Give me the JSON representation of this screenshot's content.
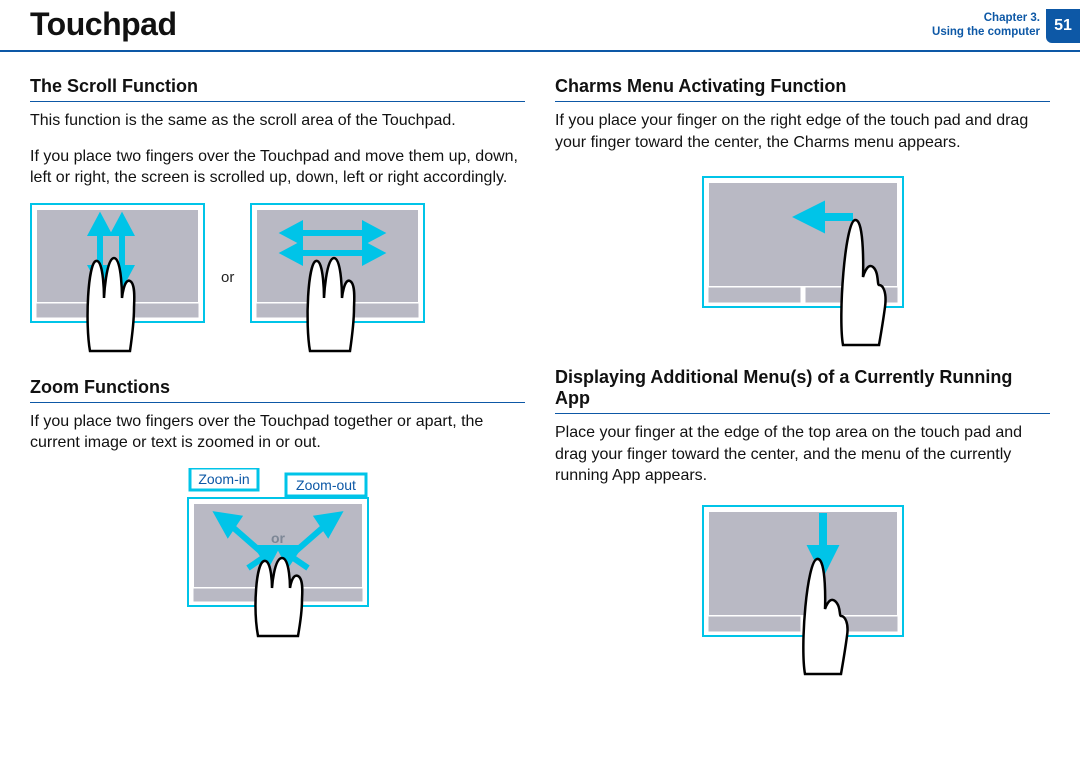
{
  "header": {
    "title": "Touchpad",
    "chapter_line1": "Chapter 3.",
    "chapter_line2": "Using the computer",
    "page_number": "51"
  },
  "left": {
    "scroll": {
      "heading": "The Scroll Function",
      "p1": "This function is the same as the scroll area of the Touchpad.",
      "p2": "If you place two fingers over the Touchpad and move them up, down, left or right, the screen is scrolled up, down, left or right accordingly.",
      "or": "or"
    },
    "zoom": {
      "heading": "Zoom Functions",
      "p1": "If you place two fingers over the Touchpad together or apart, the current image or text is zoomed in or out.",
      "label_in": "Zoom-in",
      "label_out": "Zoom-out",
      "or": "or"
    }
  },
  "right": {
    "charms": {
      "heading": "Charms Menu Activating Function",
      "p1": "If you place your finger on the right edge of the touch pad and drag your finger toward the center, the Charms menu appears."
    },
    "appmenu": {
      "heading": "Displaying Additional Menu(s) of a Currently Running App",
      "p1": "Place your finger at the edge of the top area on the touch pad and drag your finger toward the center, and the menu of the currently running App appears."
    }
  },
  "colors": {
    "accent_blue": "#0d58a6",
    "arrow_cyan": "#00c4e8"
  }
}
